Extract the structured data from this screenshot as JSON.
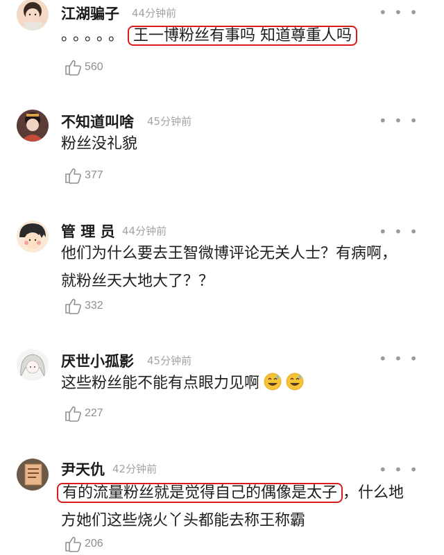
{
  "comments": [
    {
      "name": "江湖骗子",
      "time": "44分钟前",
      "prefix": "。。。。。",
      "highlight": "王一博粉丝有事吗 知道尊重人吗",
      "likes": "560",
      "avatar_icon": "girl-avatar"
    },
    {
      "name": "不知道叫啥",
      "time": "45分钟前",
      "text": "粉丝没礼貌",
      "likes": "377",
      "avatar_icon": "woman-avatar"
    },
    {
      "name": "管 理 员",
      "time": "44分钟前",
      "text_line1": "他们为什么要去王智微博评论无关人士？有病啊，",
      "text_line2": "就粉丝天大地大了？？",
      "likes": "332",
      "avatar_icon": "cartoon-avatar"
    },
    {
      "name": "厌世小孤影",
      "time": "45分钟前",
      "text": "这些粉丝能不能有点眼力见啊",
      "emojis": [
        "sweat-smile-emoji",
        "sweat-smile-emoji"
      ],
      "likes": "227",
      "avatar_icon": "anime-avatar"
    },
    {
      "name": "尹天仇",
      "time": "42分钟前",
      "highlight": "有的流量粉丝就是觉得自己的偶像是太子",
      "suffix": "，什么地",
      "text_line2": "方她们这些烧火丫头都能去称王称霸",
      "likes": "206",
      "avatar_icon": "book-avatar"
    }
  ],
  "more_icon": "more-dots-icon",
  "like_icon": "thumbs-up-icon",
  "colors": {
    "highlight_border": "#d91a1a",
    "meta_gray": "#a3a3a3",
    "text": "#1e1e1e"
  }
}
